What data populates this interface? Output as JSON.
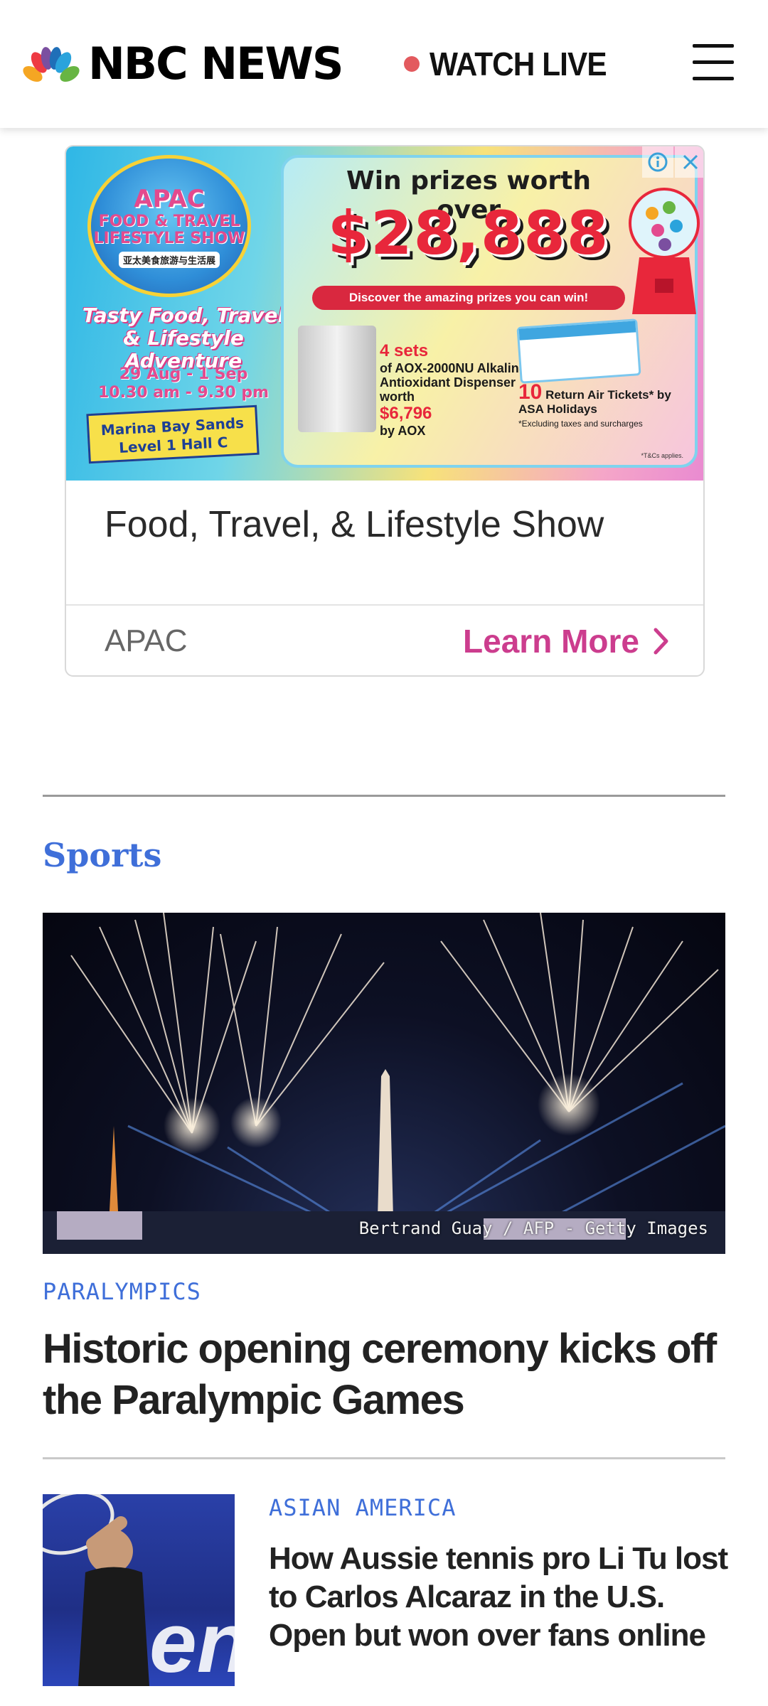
{
  "header": {
    "brand": "NBC NEWS",
    "watch_live_label": "WATCH LIVE",
    "live_dot_color": "#e35a5e"
  },
  "ad": {
    "banner": {
      "logo_apac": "APAC",
      "logo_show": "FOOD & TRAVEL LIFESTYLE SHOW",
      "logo_chinese": "亚太美食旅游与生活展",
      "tagline": "Tasty Food, Travel & Lifestyle Adventure",
      "dates": "29 Aug - 1 Sep",
      "hours": "10.30 am - 9.30 pm",
      "venue": "Marina Bay Sands Level 1 Hall C",
      "prize_heading": "Win prizes worth over",
      "prize_amount": "$28,888",
      "discover": "Discover the amazing prizes you can win!",
      "dispenser_count": "4 sets",
      "dispenser_desc": "of AOX-2000NU Alkaline Antioxidant Dispenser worth",
      "dispenser_value": "$6,796",
      "dispenser_by": "by AOX",
      "tickets_count": "10",
      "tickets_desc": "Return Air Tickets* by ASA Holidays",
      "tickets_note": "*Excluding taxes and surcharges",
      "tcs": "*T&Cs applies."
    },
    "title": "Food, Travel, & Lifestyle Show",
    "sponsor": "APAC",
    "cta_label": "Learn More",
    "cta_color": "#cc3d8e"
  },
  "sports": {
    "section_title": "Sports",
    "section_color": "#3f6fd9",
    "lead": {
      "photo_credit": "Bertrand Guay / AFP - Getty Images",
      "kicker": "PARALYMPICS",
      "headline": "Historic opening ceremony kicks off the Paralympic Games"
    },
    "story2": {
      "kicker": "ASIAN AMERICA",
      "headline": "How Aussie tennis pro Li Tu lost to Carlos Alcaraz in the U.S. Open but won over fans online"
    }
  }
}
